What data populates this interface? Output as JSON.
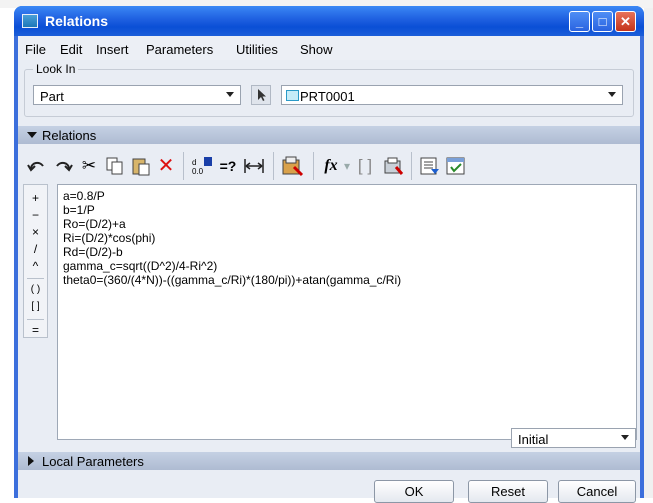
{
  "window": {
    "title": "Relations"
  },
  "menu": [
    "File",
    "Edit",
    "Insert",
    "Parameters",
    "Utilities",
    "Show"
  ],
  "look_in": {
    "legend": "Look In",
    "type_value": "Part",
    "model_value": "PRT0001"
  },
  "relations_section": {
    "label": "Relations"
  },
  "toolbar_icons": [
    "undo-icon",
    "redo-icon",
    "cut-icon",
    "copy-icon",
    "paste-icon",
    "delete-icon",
    "sort-relations-icon",
    "evaluate-selection-icon",
    "measure-icon",
    "verify-relations-icon",
    "insert-function-icon",
    "insert-parameter-icon",
    "unit-sensitivity-icon",
    "show-info-icon",
    "execute-verify-icon"
  ],
  "toolbar_labels": {
    "evaluate": "=?",
    "fx": "fx"
  },
  "operators": [
    "+",
    "−",
    "×",
    "/",
    "^",
    "( )",
    "[ ]",
    "="
  ],
  "relations": [
    "a=0.8/P",
    "b=1/P",
    "Ro=(D/2)+a",
    "Ri=(D/2)*cos(phi)",
    "Rd=(D/2)-b",
    "gamma_c=sqrt((D^2)/4-Ri^2)",
    "theta0=(360/(4*N))-((gamma_c/Ri)*(180/pi))+atan(gamma_c/Ri)"
  ],
  "regen_option": "Initial",
  "local_parameters": {
    "label": "Local Parameters"
  },
  "buttons": {
    "ok": "OK",
    "reset": "Reset",
    "cancel": "Cancel"
  },
  "colors": {
    "titlebar": "#0a4fd6",
    "close_button": "#c4331a",
    "section_bar": "#aebbd2",
    "client_bg": "#e9edf4"
  }
}
